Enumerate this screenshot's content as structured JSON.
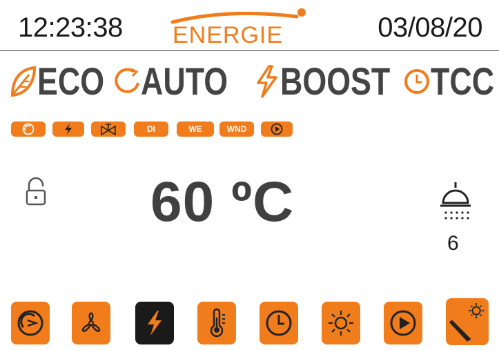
{
  "header": {
    "time": "12:23:38",
    "logo": "ENERGIE",
    "date": "03/08/20"
  },
  "modes": [
    {
      "label": "ECO",
      "icon": "leaf-icon"
    },
    {
      "label": "AUTO",
      "icon": "refresh-icon"
    },
    {
      "label": "BOOST",
      "icon": "lightning-icon"
    },
    {
      "label": "TCC",
      "icon": "clock-icon"
    }
  ],
  "status_pills": [
    {
      "icon": "compressor-icon",
      "text": ""
    },
    {
      "icon": "lightning-icon",
      "text": ""
    },
    {
      "icon": "valve-icon",
      "text": ""
    },
    {
      "icon": "",
      "text": "DI"
    },
    {
      "icon": "",
      "text": "WE"
    },
    {
      "icon": "",
      "text": "WND"
    },
    {
      "icon": "play-icon",
      "text": ""
    }
  ],
  "main": {
    "temperature": "60 ºC",
    "lock_icon": "unlock-icon",
    "shower_icon": "shower-icon",
    "shower_count": "6"
  },
  "bottom_buttons": [
    {
      "icon": "compressor-icon"
    },
    {
      "icon": "fan-icon"
    },
    {
      "icon": "lightning-icon"
    },
    {
      "icon": "thermometer-icon"
    },
    {
      "icon": "clock-icon"
    },
    {
      "icon": "sun-icon"
    },
    {
      "icon": "play-icon"
    },
    {
      "icon": "solar-panel-icon"
    }
  ],
  "colors": {
    "accent": "#f07c1c",
    "text_dark": "#404040",
    "active_button": "#1a1a1a"
  }
}
